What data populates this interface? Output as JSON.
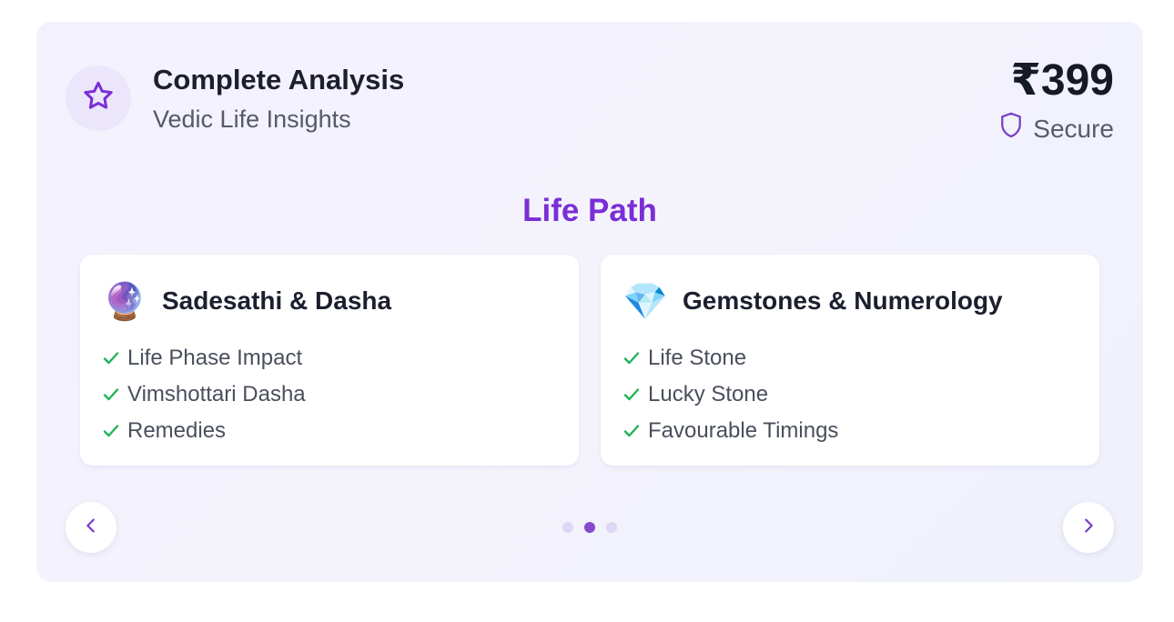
{
  "header": {
    "title": "Complete Analysis",
    "subtitle": "Vedic Life Insights",
    "price": "₹399",
    "secure_label": "Secure",
    "badge_icon": "star-icon",
    "secure_icon": "shield-icon"
  },
  "section": {
    "title": "Life Path"
  },
  "features": [
    {
      "icon": "crystal-ball-icon",
      "emoji": "🔮",
      "title": "Sadesathi & Dasha",
      "items": [
        "Life Phase Impact",
        "Vimshottari Dasha",
        "Remedies"
      ]
    },
    {
      "icon": "gem-icon",
      "emoji": "💎",
      "title": "Gemstones & Numerology",
      "items": [
        "Life Stone",
        "Lucky Stone",
        "Favourable Timings"
      ]
    }
  ],
  "carousel": {
    "prev_icon": "chevron-left-icon",
    "next_icon": "chevron-right-icon",
    "dot_count": 3,
    "active_dot": 2
  },
  "colors": {
    "accent": "#7a2ed6",
    "check": "#22b35a",
    "card_bg": "#f3f1fd",
    "active_dot": "#8449cf",
    "inactive_dot": "#ddd6f4"
  }
}
